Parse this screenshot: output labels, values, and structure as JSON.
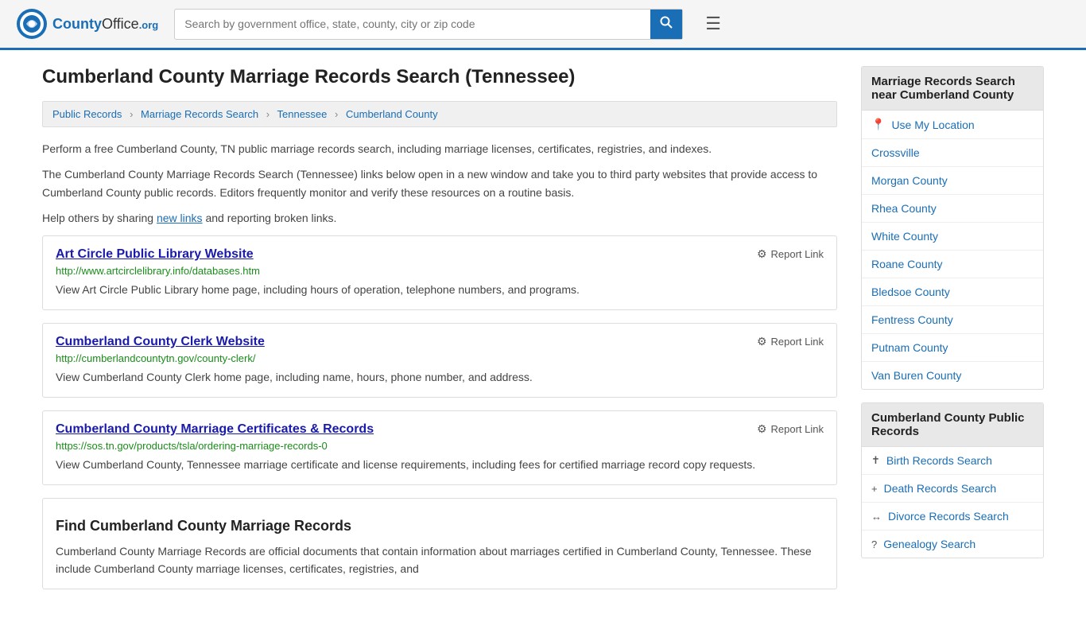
{
  "header": {
    "logo_text_main": "County",
    "logo_text_suffix": "Office",
    "logo_domain": ".org",
    "search_placeholder": "Search by government office, state, county, city or zip code",
    "menu_icon": "☰",
    "search_icon": "🔍"
  },
  "page": {
    "title": "Cumberland County Marriage Records Search (Tennessee)",
    "breadcrumb": [
      {
        "label": "Public Records",
        "href": "#"
      },
      {
        "label": "Marriage Records Search",
        "href": "#"
      },
      {
        "label": "Tennessee",
        "href": "#"
      },
      {
        "label": "Cumberland County",
        "href": "#"
      }
    ],
    "intro_paragraphs": [
      "Perform a free Cumberland County, TN public marriage records search, including marriage licenses, certificates, registries, and indexes.",
      "The Cumberland County Marriage Records Search (Tennessee) links below open in a new window and take you to third party websites that provide access to Cumberland County public records. Editors frequently monitor and verify these resources on a routine basis.",
      "Help others by sharing new links and reporting broken links."
    ],
    "new_links_text": "new links",
    "results": [
      {
        "title": "Art Circle Public Library Website",
        "url": "http://www.artcirclelibrary.info/databases.htm",
        "description": "View Art Circle Public Library home page, including hours of operation, telephone numbers, and programs.",
        "report_label": "Report Link"
      },
      {
        "title": "Cumberland County Clerk Website",
        "url": "http://cumberlandcountytn.gov/county-clerk/",
        "description": "View Cumberland County Clerk home page, including name, hours, phone number, and address.",
        "report_label": "Report Link"
      },
      {
        "title": "Cumberland County Marriage Certificates & Records",
        "url": "https://sos.tn.gov/products/tsla/ordering-marriage-records-0",
        "description": "View Cumberland County, Tennessee marriage certificate and license requirements, including fees for certified marriage record copy requests.",
        "report_label": "Report Link"
      }
    ],
    "find_section": {
      "heading": "Find Cumberland County Marriage Records",
      "text": "Cumberland County Marriage Records are official documents that contain information about marriages certified in Cumberland County, Tennessee. These include Cumberland County marriage licenses, certificates, registries, and"
    }
  },
  "sidebar": {
    "nearby_section": {
      "title": "Marriage Records Search near Cumberland County",
      "use_location_label": "Use My Location",
      "items": [
        {
          "label": "Crossville",
          "href": "#"
        },
        {
          "label": "Morgan County",
          "href": "#"
        },
        {
          "label": "Rhea County",
          "href": "#"
        },
        {
          "label": "White County",
          "href": "#"
        },
        {
          "label": "Roane County",
          "href": "#"
        },
        {
          "label": "Bledsoe County",
          "href": "#"
        },
        {
          "label": "Fentress County",
          "href": "#"
        },
        {
          "label": "Putnam County",
          "href": "#"
        },
        {
          "label": "Van Buren County",
          "href": "#"
        }
      ]
    },
    "public_records_section": {
      "title": "Cumberland County Public Records",
      "items": [
        {
          "label": "Birth Records Search",
          "icon": "✝",
          "href": "#"
        },
        {
          "label": "Death Records Search",
          "icon": "+",
          "href": "#"
        },
        {
          "label": "Divorce Records Search",
          "icon": "↔",
          "href": "#"
        },
        {
          "label": "Genealogy Search",
          "icon": "?",
          "href": "#"
        }
      ]
    }
  }
}
